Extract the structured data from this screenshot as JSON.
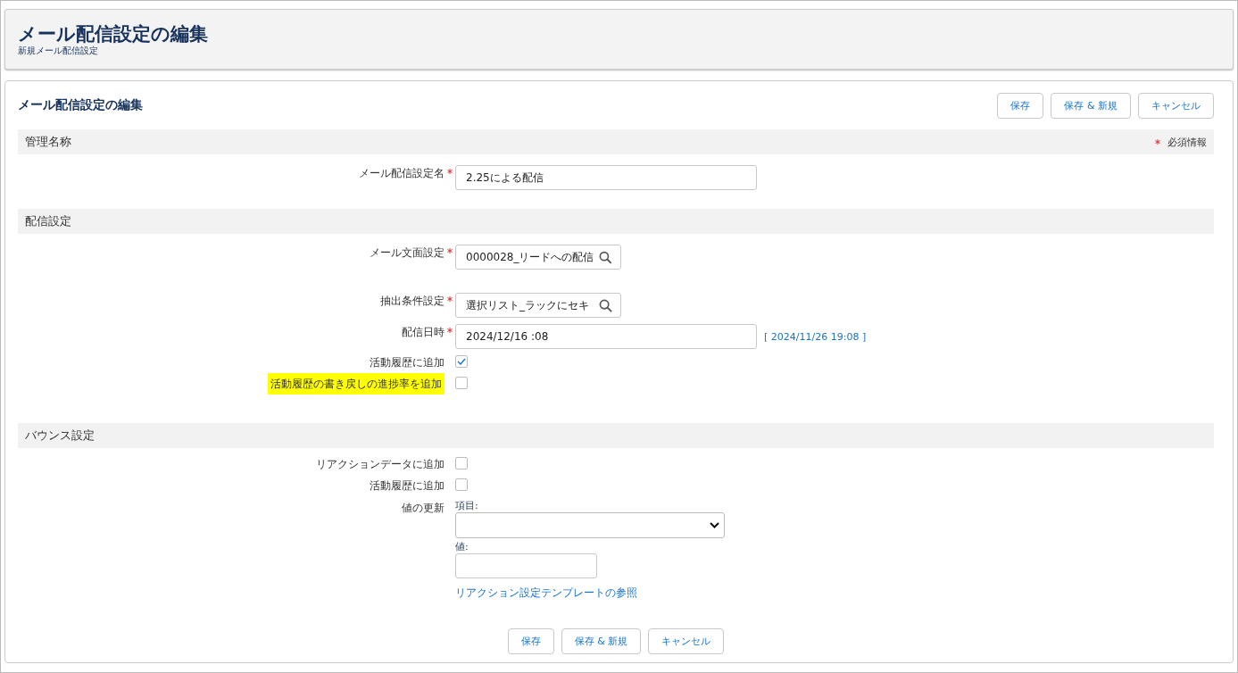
{
  "header": {
    "title": "メール配信設定の編集",
    "subtitle": "新規メール配信設定"
  },
  "form": {
    "title": "メール配信設定の編集",
    "buttons": [
      "保存",
      "保存 & 新規",
      "キャンセル"
    ],
    "required_legend": "必須情報",
    "sections": [
      {
        "title": "管理名称",
        "fields": [
          {
            "kind": "text",
            "label": "メール配信設定名",
            "required": true,
            "value": "2.25による配信"
          }
        ]
      },
      {
        "title": "配信設定",
        "fields": [
          {
            "kind": "lookup",
            "label": "メール文面設定",
            "required": true,
            "value": "0000028_リードへの配信"
          },
          {
            "kind": "lookup",
            "label": "抽出条件設定",
            "required": true,
            "value": "選択リスト_ラックにセキ"
          },
          {
            "kind": "datetime",
            "label": "配信日時",
            "required": true,
            "value": "2024/12/16 :08",
            "link": "[ 2024/11/26 19:08 ]"
          },
          {
            "kind": "checkbox",
            "label": "活動履歴に追加",
            "required": false,
            "checked": true,
            "highlighted": false
          },
          {
            "kind": "checkbox",
            "label": "活動履歴の書き戻しの進捗率を追加",
            "required": false,
            "checked": false,
            "highlighted": true
          }
        ]
      },
      {
        "title": "バウンス設定",
        "fields": [
          {
            "kind": "checkbox",
            "label": "リアクションデータに追加",
            "required": false,
            "checked": false,
            "highlighted": false
          },
          {
            "kind": "checkbox",
            "label": "活動履歴に追加",
            "required": false,
            "checked": false,
            "highlighted": false
          },
          {
            "kind": "update",
            "label": "値の更新",
            "required": false,
            "item_label": "項目:",
            "value_label": "値:",
            "link": "リアクション設定テンプレートの参照"
          }
        ]
      }
    ],
    "footer_buttons": [
      "保存",
      "保存 & 新規",
      "キャンセル"
    ]
  }
}
